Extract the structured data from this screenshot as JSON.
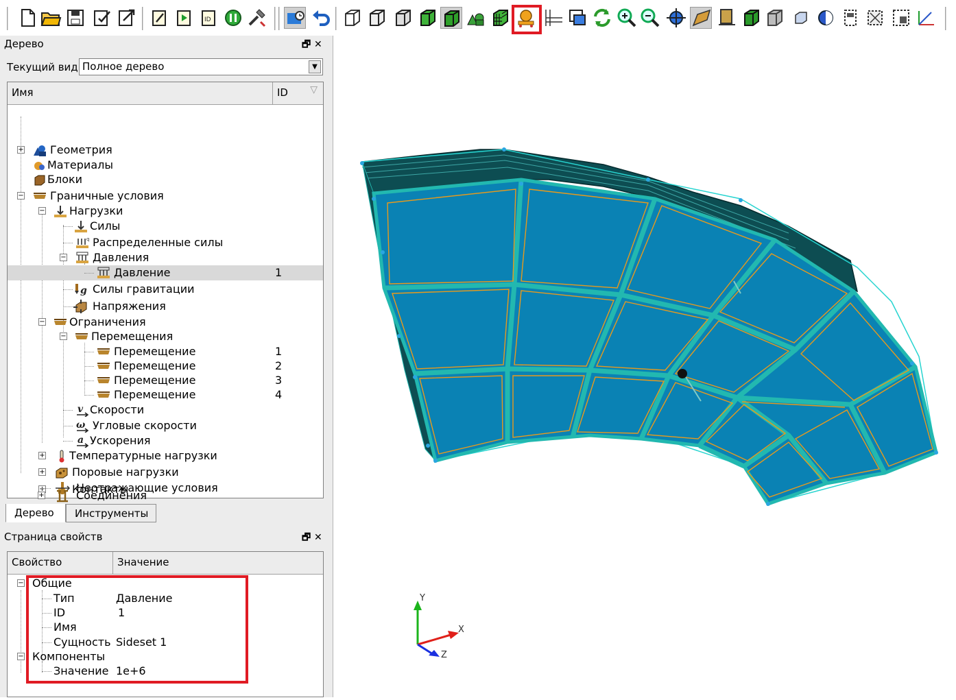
{
  "toolbar": {
    "icons": [
      "new-file-icon",
      "open-folder-icon",
      "save-icon",
      "check-doc-icon",
      "export-doc-icon",
      "edit-doc-icon",
      "run-doc-icon",
      "id-doc-icon",
      "pause-icon",
      "tool-icon",
      "history-icon",
      "undo-icon",
      "wire-cube-icon",
      "wire-cube-2-icon",
      "wire-cube-3-icon",
      "green-cube-icon",
      "green-cube-active-icon",
      "shapes-icon",
      "mesh-cube-icon",
      "block-tool-icon",
      "grid-icon",
      "window-icon",
      "refresh-icon",
      "zoom-in-icon",
      "zoom-out-icon",
      "rotate-icon",
      "surface-icon",
      "panel-icon",
      "green-block-icon",
      "gray-block-icon",
      "cube-small-icon",
      "sphere-icon",
      "frame-icon",
      "frame-2-icon",
      "frame-3-icon",
      "axes-icon"
    ]
  },
  "tree_panel": {
    "title": "Дерево",
    "controls": "🗗 ✕",
    "view_label": "Текущий вид",
    "view_value": "Полное дерево",
    "col_name": "Имя",
    "col_id": "ID",
    "items": [
      {
        "label": "Геометрия",
        "id": ""
      },
      {
        "label": "Материалы",
        "id": ""
      },
      {
        "label": "Блоки",
        "id": ""
      },
      {
        "label": "Граничные условия",
        "id": ""
      },
      {
        "label": "Нагрузки",
        "id": ""
      },
      {
        "label": "Силы",
        "id": ""
      },
      {
        "label": "Распределенные силы",
        "id": ""
      },
      {
        "label": "Давления",
        "id": ""
      },
      {
        "label": "Давление",
        "id": "1"
      },
      {
        "label": "Силы гравитации",
        "id": ""
      },
      {
        "label": "Напряжения",
        "id": ""
      },
      {
        "label": "Ограничения",
        "id": ""
      },
      {
        "label": "Перемещения",
        "id": ""
      },
      {
        "label": "Перемещение",
        "id": "1"
      },
      {
        "label": "Перемещение",
        "id": "2"
      },
      {
        "label": "Перемещение",
        "id": "3"
      },
      {
        "label": "Перемещение",
        "id": "4"
      },
      {
        "label": "Скорости",
        "id": ""
      },
      {
        "label": "Угловые скорости",
        "id": ""
      },
      {
        "label": "Ускорения",
        "id": ""
      },
      {
        "label": "Температурные нагрузки",
        "id": ""
      },
      {
        "label": "Поровые нагрузки",
        "id": ""
      },
      {
        "label": "Контакты",
        "id": ""
      },
      {
        "label": "Соединения",
        "id": ""
      },
      {
        "label": "Неотражающие условия",
        "id": ""
      }
    ]
  },
  "tabs": [
    "Дерево",
    "Инструменты"
  ],
  "props_panel": {
    "title": "Страница свойств",
    "controls": "🗗 ✕",
    "col_prop": "Свойство",
    "col_value": "Значение",
    "group_general": "Общие",
    "rows": [
      {
        "prop": "Тип",
        "value": "Давление"
      },
      {
        "prop": "ID",
        "value": "1"
      },
      {
        "prop": "Имя",
        "value": ""
      },
      {
        "prop": "Сущность",
        "value": "Sideset 1"
      }
    ],
    "group_components": "Компоненты",
    "comp_rows": [
      {
        "prop": "Значение",
        "value": "1e+6"
      }
    ]
  },
  "axes": {
    "x": "X",
    "y": "Y",
    "z": "Z"
  },
  "colors": {
    "highlight": "#e01b24",
    "mesh_face": "#0a82b4",
    "mesh_edge": "#22b8b0",
    "mesh_dark": "#0d4d52",
    "mesh_line": "#e89a1c"
  }
}
